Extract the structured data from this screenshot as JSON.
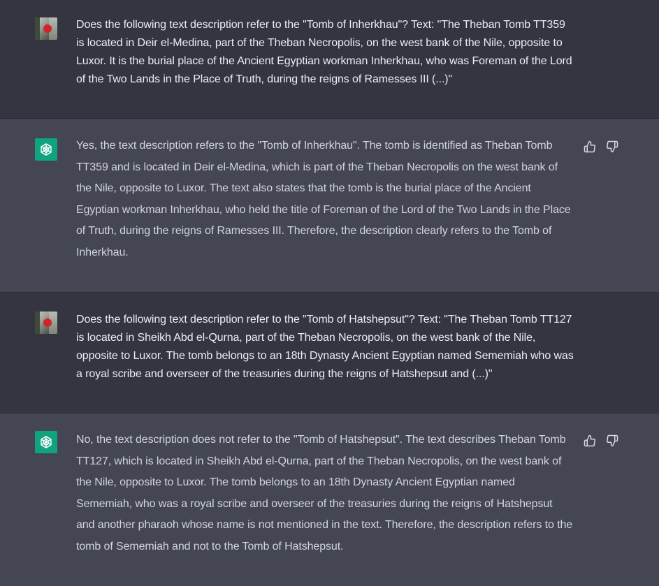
{
  "messages": [
    {
      "role": "user",
      "avatar": "user-photo",
      "text": "Does the following text description refer to the \"Tomb of Inherkhau\"? Text: \"The Theban Tomb TT359 is located in Deir el-Medina, part of the Theban Necropolis, on the west bank of the Nile, opposite to Luxor. It is the burial place of the Ancient Egyptian workman Inherkhau, who was Foreman of the Lord of the Two Lands in the Place of Truth, during the reigns of Ramesses III (...)\""
    },
    {
      "role": "assistant",
      "avatar": "openai-logo-icon",
      "text": "Yes, the text description refers to the \"Tomb of Inherkhau\". The tomb is identified as Theban Tomb TT359 and is located in Deir el-Medina, which is part of the Theban Necropolis on the west bank of the Nile, opposite to Luxor. The text also states that the tomb is the burial place of the Ancient Egyptian workman Inherkhau, who held the title of Foreman of the Lord of the Two Lands in the Place of Truth, during the reigns of Ramesses III. Therefore, the description clearly refers to the Tomb of Inherkhau.",
      "feedback": [
        "thumbs-up-icon",
        "thumbs-down-icon"
      ]
    },
    {
      "role": "user",
      "avatar": "user-photo",
      "text": "Does the following text description refer to the \"Tomb of Hatshepsut\"? Text: \"The Theban Tomb TT127 is located in Sheikh Abd el-Qurna, part of the Theban Necropolis, on the west bank of the Nile, opposite to Luxor. The tomb belongs to an 18th Dynasty Ancient Egyptian named Sememiah who was a royal scribe and overseer of the treasuries during the reigns of Hatshepsut and (...)\""
    },
    {
      "role": "assistant",
      "avatar": "openai-logo-icon",
      "text": "No, the text description does not refer to the \"Tomb of Hatshepsut\". The text describes Theban Tomb TT127, which is located in Sheikh Abd el-Qurna, part of the Theban Necropolis, on the west bank of the Nile, opposite to Luxor. The tomb belongs to an 18th Dynasty Ancient Egyptian named Sememiah, who was a royal scribe and overseer of the treasuries during the reigns of Hatshepsut and another pharaoh whose name is not mentioned in the text. Therefore, the description refers to the tomb of Sememiah and not to the Tomb of Hatshepsut.",
      "feedback": [
        "thumbs-up-icon",
        "thumbs-down-icon"
      ]
    }
  ],
  "colors": {
    "user_bg": "#343541",
    "assistant_bg": "#444654",
    "bot_avatar": "#10a37f",
    "text": "#ececf1"
  }
}
